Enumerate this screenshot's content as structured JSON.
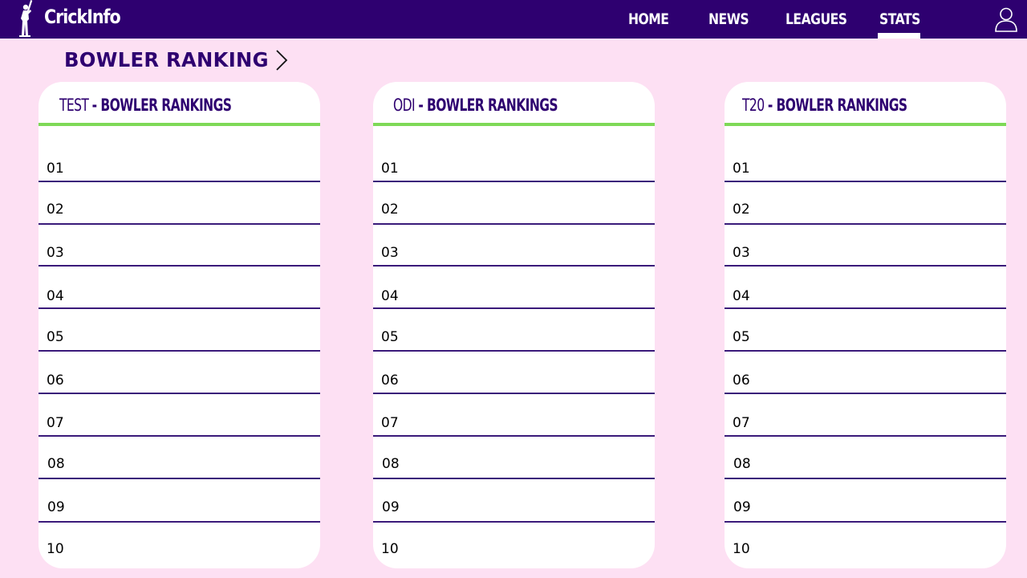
{
  "header": {
    "brand": "CrickInfo",
    "nav": [
      {
        "label": "HOME"
      },
      {
        "label": "NEWS"
      },
      {
        "label": "LEAGUES"
      },
      {
        "label": "STATS",
        "active": true
      }
    ]
  },
  "page": {
    "section_title": "BOWLER RANKING"
  },
  "cards": [
    {
      "format": "TEST",
      "title_rest": "- BOWLER RANKINGS",
      "rows": [
        "01",
        "02",
        "03",
        "04",
        "05",
        "06",
        "07",
        "08",
        "09",
        "10"
      ]
    },
    {
      "format": "ODI",
      "title_rest": "- BOWLER RANKINGS",
      "rows": [
        "01",
        "02",
        "03",
        "04",
        "05",
        "06",
        "07",
        "08",
        "09",
        "10"
      ]
    },
    {
      "format": "T20",
      "title_rest": "- BOWLER RANKINGS",
      "rows": [
        "01",
        "02",
        "03",
        "04",
        "05",
        "06",
        "07",
        "08",
        "09",
        "10"
      ]
    }
  ],
  "colors": {
    "nav_bg": "#2e0070",
    "page_bg": "#fde0f3",
    "accent_green": "#7ed957",
    "title_purple": "#2e0070"
  },
  "icons": {
    "logo": "cricket-batsman-icon",
    "user": "user-icon",
    "chevron": "chevron-right-icon"
  }
}
